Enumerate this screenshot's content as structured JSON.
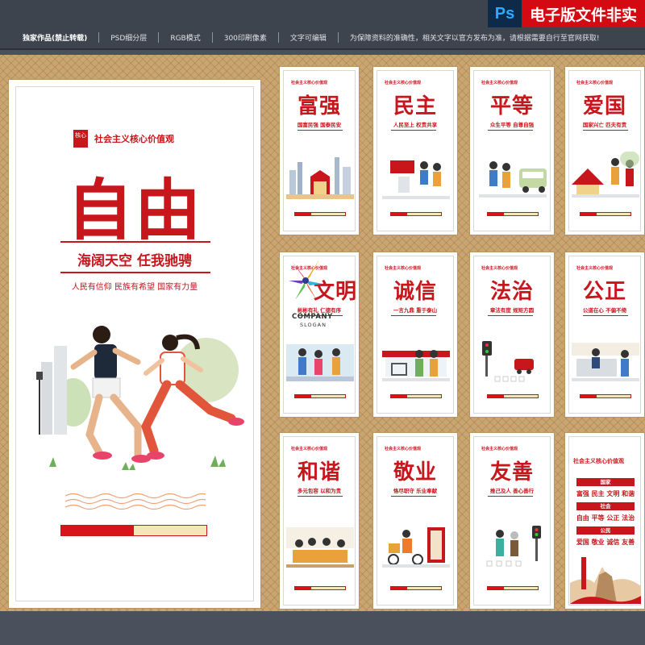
{
  "infobar": {
    "items": [
      "独家作品(禁止转载)",
      "PSD细分层",
      "RGB模式",
      "300印刷像素",
      "文字可编辑",
      "为保障资料的准确性，相关文字以官方发布为准，请根据需要自行至官网获取!"
    ]
  },
  "ps_badge": {
    "icon": "Ps",
    "text": "电子版文件非实"
  },
  "big_poster": {
    "seal": "核心",
    "header": "社会主义核心价值观",
    "title": "自由",
    "slogan": "海阔天空 任我驰骋",
    "subslogan": "人民有信仰 民族有希望 国家有力量",
    "progress": 0.5
  },
  "small_posters": [
    {
      "header": "社会主义核心价值观",
      "title": "富强",
      "sub": "国富民强 国泰民安"
    },
    {
      "header": "社会主义核心价值观",
      "title": "民主",
      "sub": "人民至上 权责共享"
    },
    {
      "header": "社会主义核心价值观",
      "title": "平等",
      "sub": "众生平等 自尊自强"
    },
    {
      "header": "社会主义核心价值观",
      "title": "爱国",
      "sub": "国家兴亡 匹夫有责"
    },
    {
      "header": "社会主义核心价值观",
      "title": "文明",
      "sub": "彬彬有礼 仁德有序"
    },
    {
      "header": "社会主义核心价值观",
      "title": "诚信",
      "sub": "一言九鼎 重于泰山"
    },
    {
      "header": "社会主义核心价值观",
      "title": "法治",
      "sub": "章法有度 规矩方圆"
    },
    {
      "header": "社会主义核心价值观",
      "title": "公正",
      "sub": "公道在心 不偏不倚"
    },
    {
      "header": "社会主义核心价值观",
      "title": "和谐",
      "sub": "多元包容 以和为贵"
    },
    {
      "header": "社会主义核心价值观",
      "title": "敬业",
      "sub": "恪尽职守 乐业奉献"
    },
    {
      "header": "社会主义核心价值观",
      "title": "友善",
      "sub": "推己及人 善心善行"
    }
  ],
  "company": {
    "name": "COMPANY",
    "slogan": "SLOGAN"
  },
  "values_poster": {
    "header": "社会主义核心价值观",
    "groups": [
      {
        "label": "国家",
        "line": "富强 民主 文明 和谐"
      },
      {
        "label": "社会",
        "line": "自由 平等 公正 法治"
      },
      {
        "label": "公民",
        "line": "爱国 敬业 诚信 友善"
      }
    ]
  },
  "colors": {
    "accent": "#c8161d",
    "frame": "#c9a571",
    "background": "#4a515c"
  }
}
